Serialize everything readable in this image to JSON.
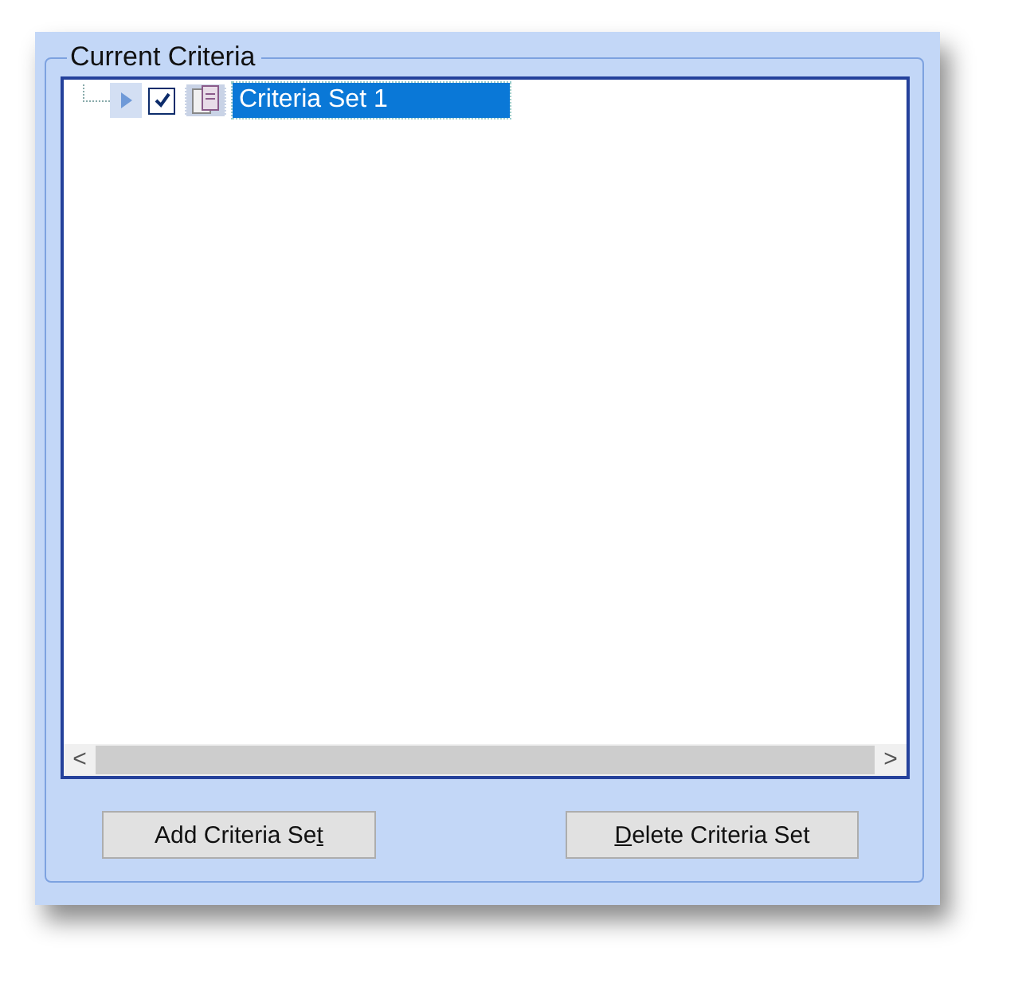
{
  "group": {
    "title": "Current Criteria"
  },
  "tree": {
    "items": [
      {
        "label": "Criteria Set 1",
        "checked": true,
        "selected": true,
        "expanded": false
      }
    ]
  },
  "scrollbar": {
    "left": "<",
    "right": ">"
  },
  "buttons": [
    {
      "parts": [
        {
          "text": "Add Criteria Se",
          "underlined": false
        },
        {
          "text": "t",
          "underlined": true
        }
      ]
    },
    {
      "parts": [
        {
          "text": "D",
          "underlined": true
        },
        {
          "text": "elete Criteria Set",
          "underlined": false
        }
      ]
    }
  ]
}
